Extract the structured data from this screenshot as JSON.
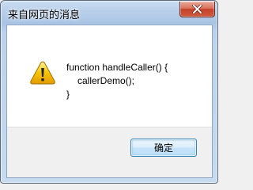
{
  "window": {
    "title": "来自网页的消息",
    "close_icon": "close-icon"
  },
  "dialog": {
    "icon": "warning-icon",
    "message_lines": [
      "function handleCaller() {",
      "callerDemo();",
      "}"
    ],
    "ok_label": "确定"
  },
  "colors": {
    "titlebar_glass": "#b8cfe9",
    "close_button": "#c4422a",
    "content_bg": "#ffffff",
    "footer_bg": "#f0f0f0",
    "warning_yellow": "#f5c400",
    "ok_button_border": "#3c7fb1"
  }
}
